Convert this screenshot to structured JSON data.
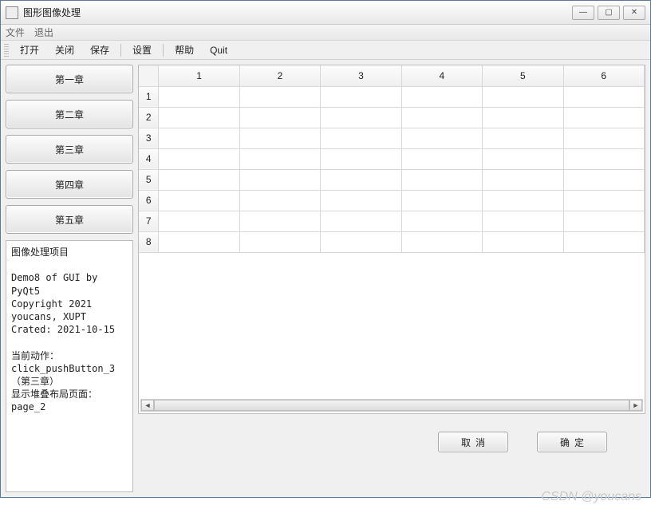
{
  "window": {
    "title": "图形图像处理",
    "controls": {
      "min": "—",
      "max": "▢",
      "close": "✕"
    }
  },
  "menubar": {
    "file": "文件",
    "exit": "退出"
  },
  "toolbar": {
    "open": "打开",
    "close": "关闭",
    "save": "保存",
    "settings": "设置",
    "help": "帮助",
    "quit": "Quit"
  },
  "sidebar": {
    "buttons": [
      "第一章",
      "第二章",
      "第三章",
      "第四章",
      "第五章"
    ]
  },
  "infobox": {
    "title": "图像处理项目",
    "line1": "Demo8 of GUI by PyQt5",
    "line2": "Copyright 2021 youcans, XUPT",
    "line3": "Crated: 2021-10-15",
    "line4": "当前动作：",
    "line5": "click_pushButton_3（第三章）",
    "line6": "显示堆叠布局页面：page_2"
  },
  "table": {
    "cols": [
      "1",
      "2",
      "3",
      "4",
      "5",
      "6"
    ],
    "rows": [
      "1",
      "2",
      "3",
      "4",
      "5",
      "6",
      "7",
      "8"
    ]
  },
  "buttons": {
    "cancel": "取消",
    "ok": "确定"
  },
  "watermark": "CSDN @youcans"
}
